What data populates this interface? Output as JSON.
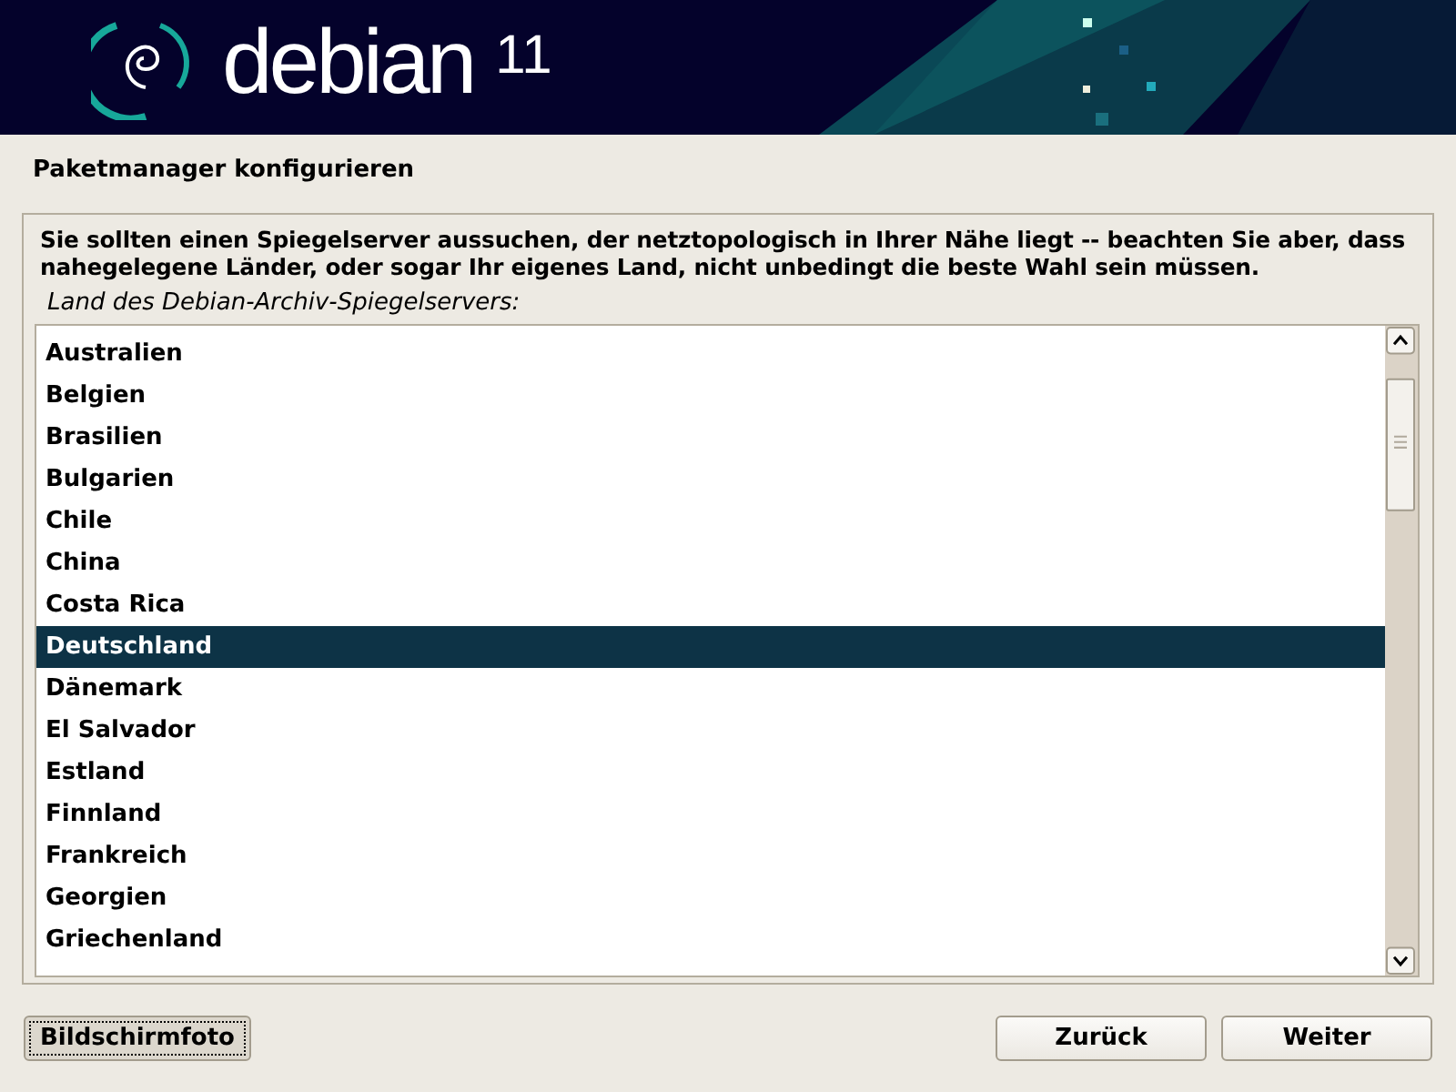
{
  "header": {
    "brand": "debian",
    "version": "11"
  },
  "title": "Paketmanager konfigurieren",
  "description": "Sie sollten einen Spiegelserver aussuchen, der netztopologisch in Ihrer Nähe liegt -- beachten Sie aber, dass nahegelegene Länder, oder sogar Ihr eigenes Land, nicht unbedingt die beste Wahl sein müssen.",
  "list_label": "Land des Debian-Archiv-Spiegelservers:",
  "countries": [
    {
      "label": "Australien",
      "selected": false
    },
    {
      "label": "Belgien",
      "selected": false
    },
    {
      "label": "Brasilien",
      "selected": false
    },
    {
      "label": "Bulgarien",
      "selected": false
    },
    {
      "label": "Chile",
      "selected": false
    },
    {
      "label": "China",
      "selected": false
    },
    {
      "label": "Costa Rica",
      "selected": false
    },
    {
      "label": "Deutschland",
      "selected": true
    },
    {
      "label": "Dänemark",
      "selected": false
    },
    {
      "label": "El Salvador",
      "selected": false
    },
    {
      "label": "Estland",
      "selected": false
    },
    {
      "label": "Finnland",
      "selected": false
    },
    {
      "label": "Frankreich",
      "selected": false
    },
    {
      "label": "Georgien",
      "selected": false
    },
    {
      "label": "Griechenland",
      "selected": false
    }
  ],
  "buttons": [
    {
      "label": "Bildschirmfoto",
      "focused": true
    },
    {
      "label": "Zurück",
      "focused": false
    },
    {
      "label": "Weiter",
      "focused": false
    }
  ]
}
